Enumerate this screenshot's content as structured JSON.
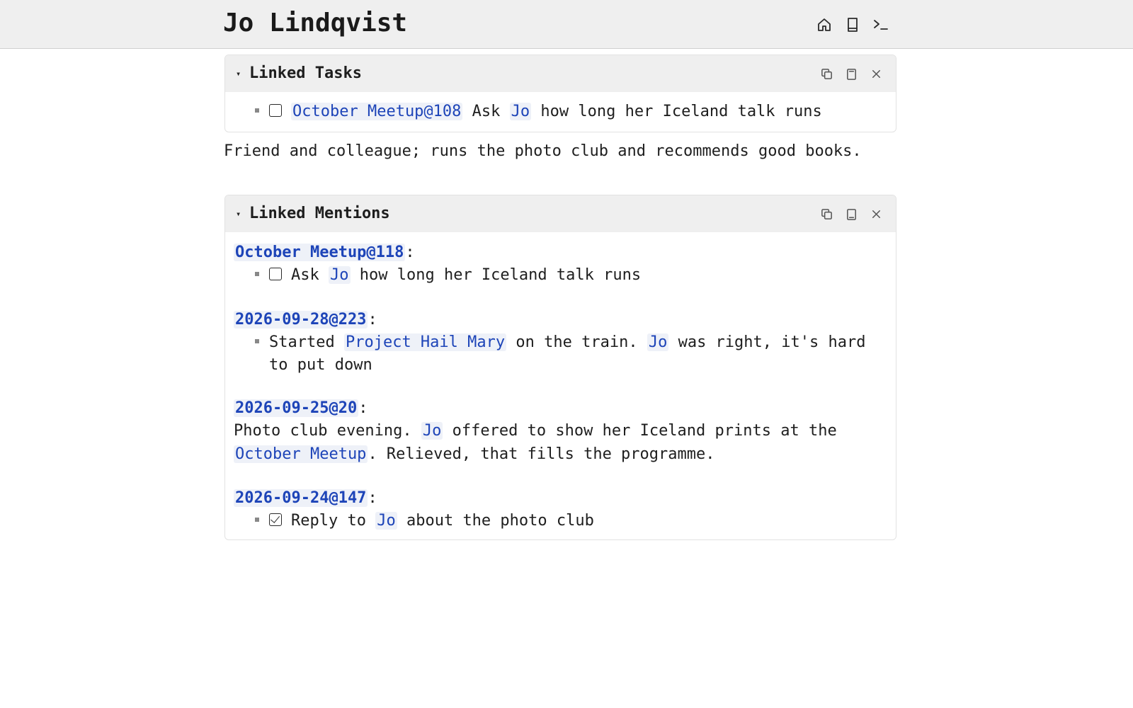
{
  "page": {
    "title": "Jo Lindqvist"
  },
  "topnav": {
    "icons": [
      "home-icon",
      "book-icon",
      "terminal-icon"
    ]
  },
  "linked_tasks": {
    "title": "Linked Tasks",
    "toggle": "▾",
    "task": {
      "ref": "October Meetup@108",
      "t1": "Ask",
      "person": "Jo",
      "t2": "how long her Iceland talk runs",
      "checked": false
    }
  },
  "description": "Friend and colleague; runs the photo club and recommends good books.",
  "linked_mentions": {
    "title": "Linked Mentions",
    "toggle": "▾",
    "groups": [
      {
        "heading": "October Meetup@118",
        "colon": ":",
        "t1": "Ask",
        "person": "Jo",
        "t2": "how long her Iceland talk runs",
        "checked": false
      },
      {
        "heading": "2026-09-28@223",
        "colon": ":",
        "t1": "Started",
        "book": "Project Hail Mary",
        "t2": "on the train.",
        "person": "Jo",
        "t3": "was right, it's hard",
        "t4": "to put down"
      },
      {
        "heading": "2026-09-25@20",
        "colon": ":",
        "t1": "Photo club evening.",
        "person": "Jo",
        "t2": "offered to show her Iceland prints at the",
        "event": "October Meetup",
        "t3": ". Relieved, that fills the programme."
      },
      {
        "heading": "2026-09-24@147",
        "colon": ":",
        "t1": "Reply to",
        "person": "Jo",
        "t2": "about the photo club",
        "checked": true
      }
    ]
  },
  "colors": {
    "link": "#1d44b8",
    "link_bg": "#eef1f8",
    "header_bg": "#efefef"
  }
}
